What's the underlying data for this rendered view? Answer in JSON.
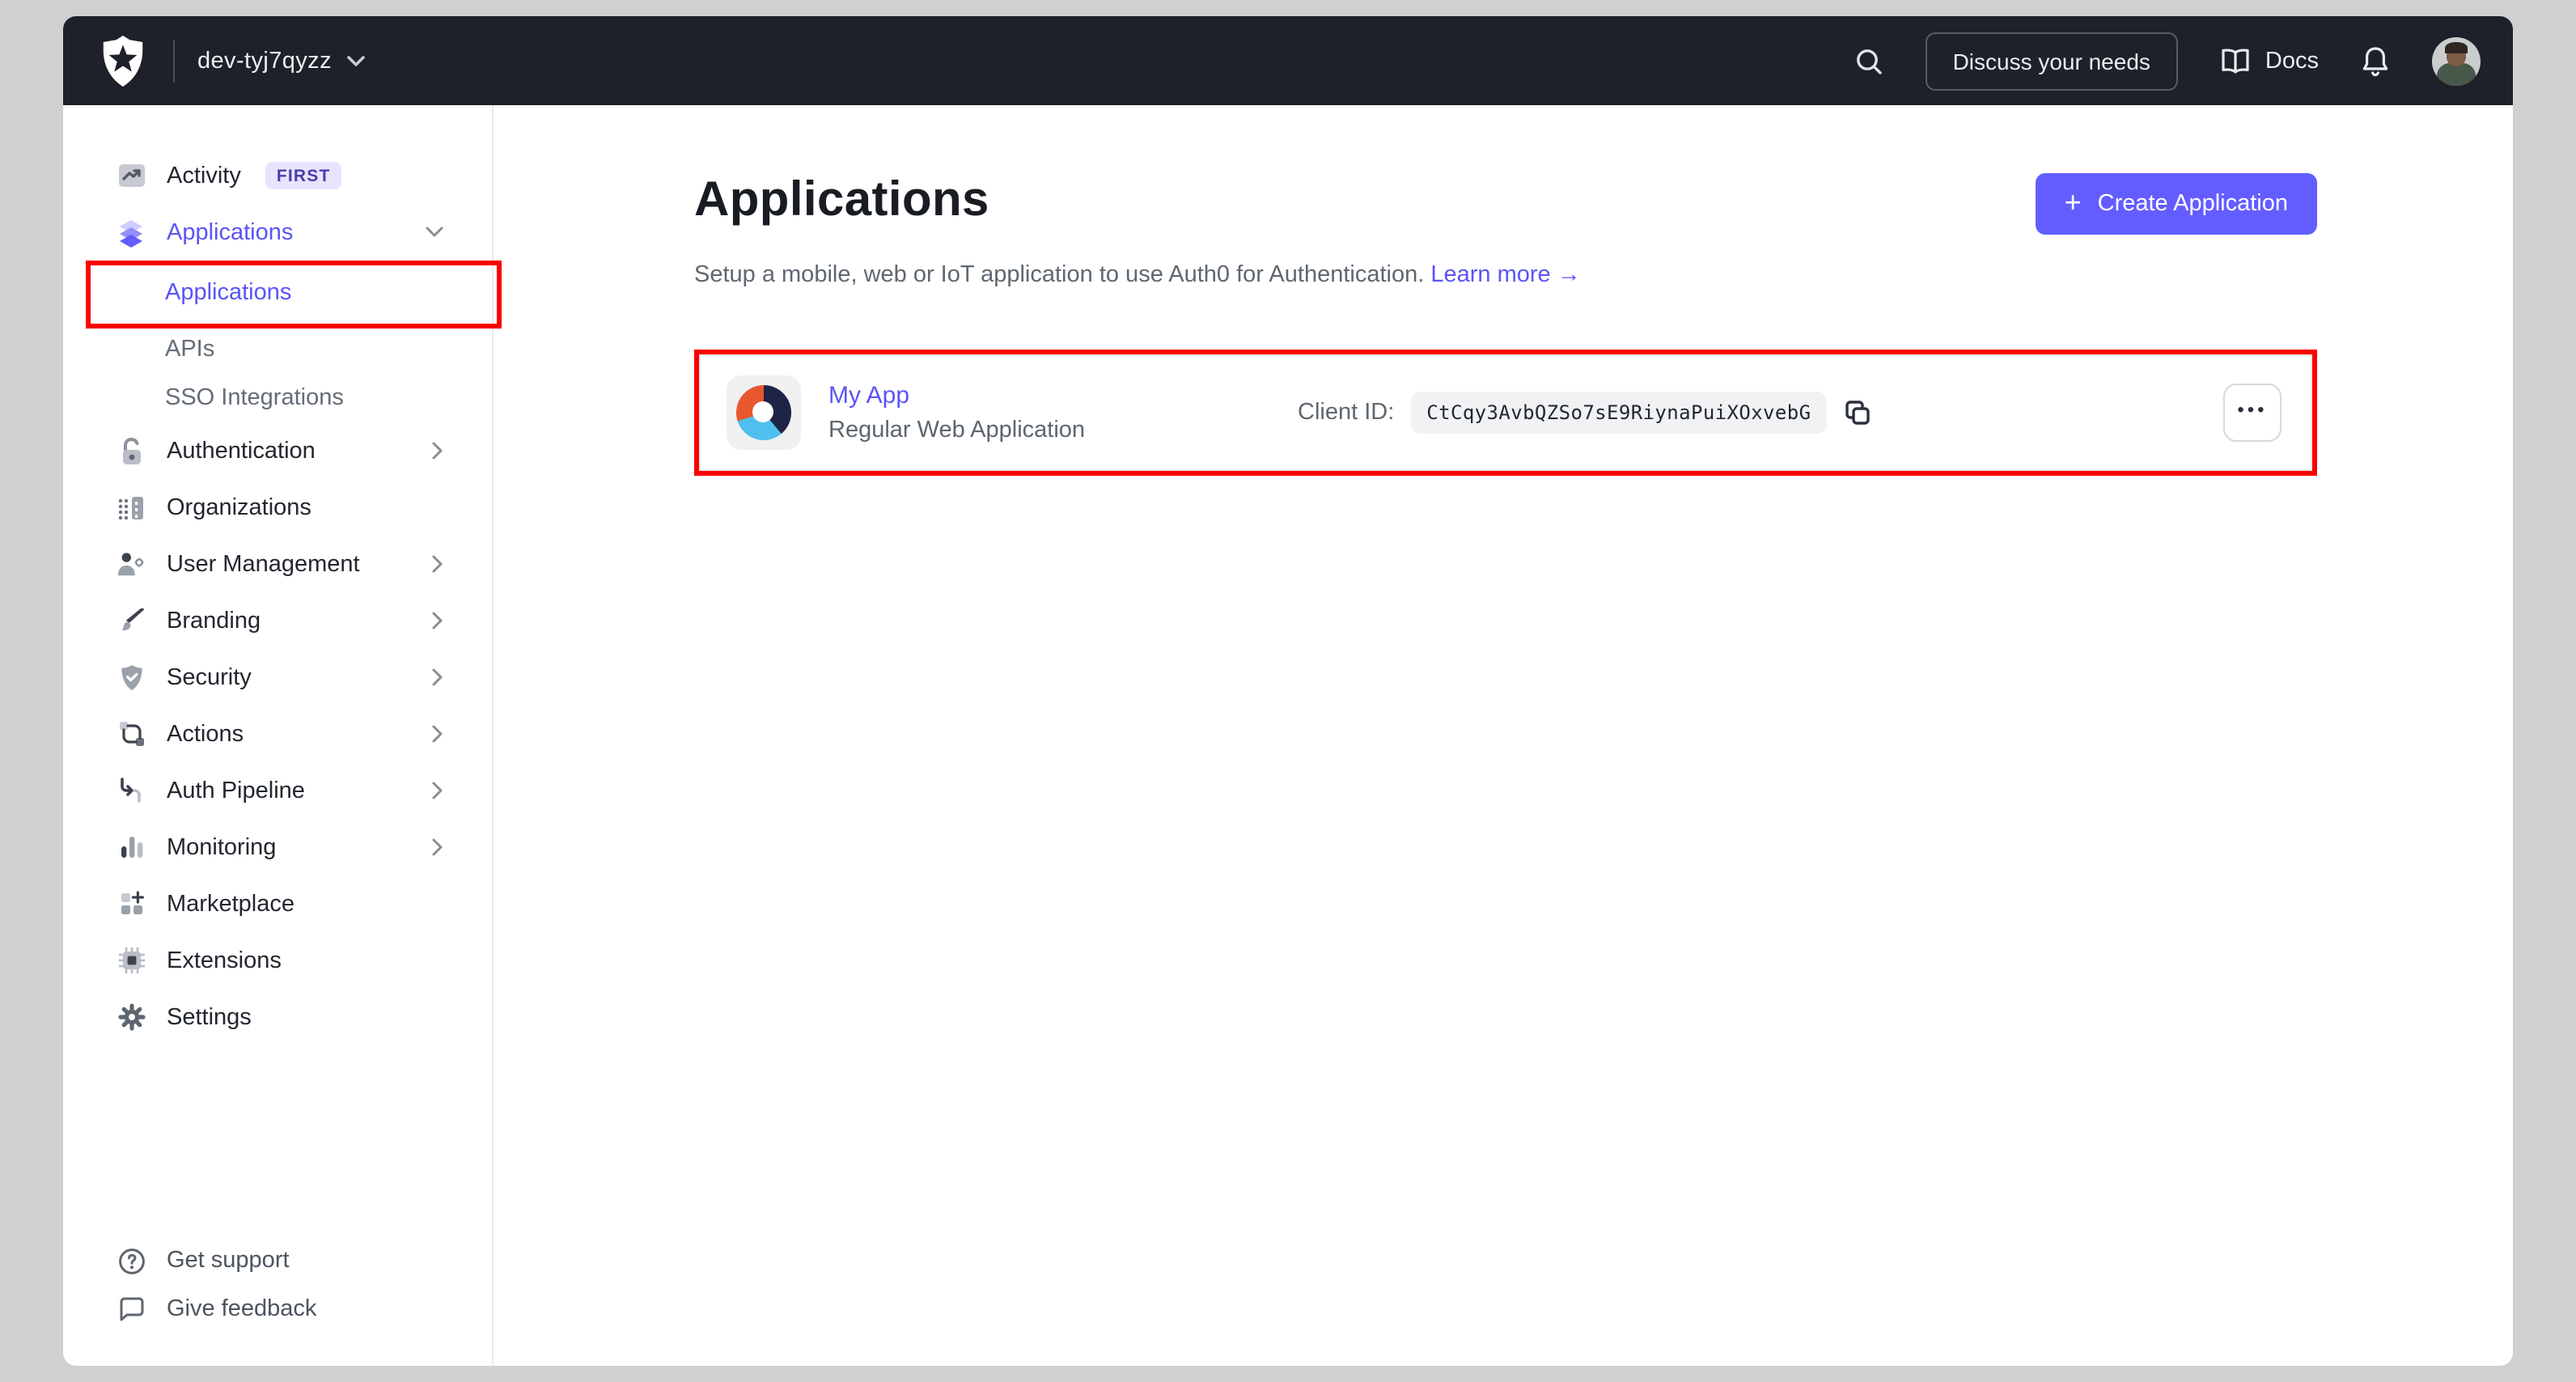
{
  "topbar": {
    "tenant": "dev-tyj7qyzz",
    "discuss_button": "Discuss your needs",
    "docs_label": "Docs"
  },
  "sidebar": {
    "items": [
      {
        "label": "Activity",
        "badge": "FIRST"
      },
      {
        "label": "Applications",
        "chevron": "down",
        "active": true
      },
      {
        "label": "Applications",
        "sub": true,
        "active": true,
        "highlighted": true
      },
      {
        "label": "APIs",
        "sub": true
      },
      {
        "label": "SSO Integrations",
        "sub": true
      },
      {
        "label": "Authentication",
        "chevron": "right"
      },
      {
        "label": "Organizations"
      },
      {
        "label": "User Management",
        "chevron": "right"
      },
      {
        "label": "Branding",
        "chevron": "right"
      },
      {
        "label": "Security",
        "chevron": "right"
      },
      {
        "label": "Actions",
        "chevron": "right"
      },
      {
        "label": "Auth Pipeline",
        "chevron": "right"
      },
      {
        "label": "Monitoring",
        "chevron": "right"
      },
      {
        "label": "Marketplace"
      },
      {
        "label": "Extensions"
      },
      {
        "label": "Settings"
      }
    ],
    "footer": [
      {
        "label": "Get support"
      },
      {
        "label": "Give feedback"
      }
    ]
  },
  "main": {
    "title": "Applications",
    "subtitle": "Setup a mobile, web or IoT application to use Auth0 for Authentication.",
    "learn_more": "Learn more",
    "learn_more_arrow": "→",
    "create_button": "Create Application",
    "create_button_plus": "+"
  },
  "application": {
    "name": "My App",
    "type": "Regular Web Application",
    "client_id_label": "Client ID:",
    "client_id": "CtCqy3AvbQZSo7sE9RiynaPuiXOxvebG",
    "menu": "•••"
  },
  "colors": {
    "accent": "#635dff",
    "link_purple": "#5a54f5",
    "topbar_bg": "#1e212a",
    "highlight_red": "#fb0000",
    "frame_gray": "#d0d0d0"
  }
}
